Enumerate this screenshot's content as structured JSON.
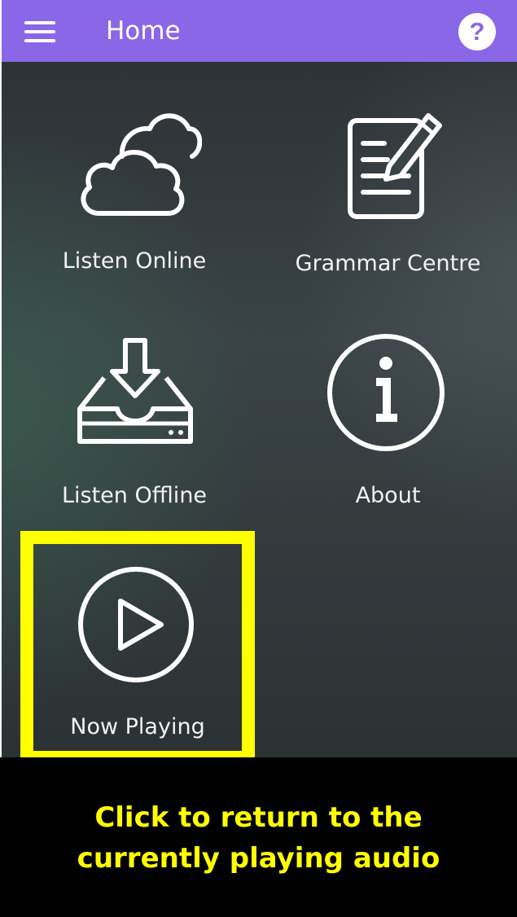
{
  "app_bar": {
    "title": "Home",
    "menu_icon": "hamburger-menu-icon",
    "help_icon": "help-question-icon",
    "help_glyph": "?",
    "background_color": "#8a67e6"
  },
  "menu": {
    "items": [
      {
        "label": "Listen Online",
        "icon": "cloud-icon"
      },
      {
        "label": "Grammar Centre",
        "icon": "document-edit-icon"
      },
      {
        "label": "Listen Offline",
        "icon": "download-tray-icon"
      },
      {
        "label": "About",
        "icon": "info-icon"
      },
      {
        "label": "Now Playing",
        "icon": "play-icon"
      }
    ]
  },
  "callout": {
    "line1": "Click to return to the",
    "line2": "currently playing audio",
    "highlight_color": "#ffff00"
  }
}
